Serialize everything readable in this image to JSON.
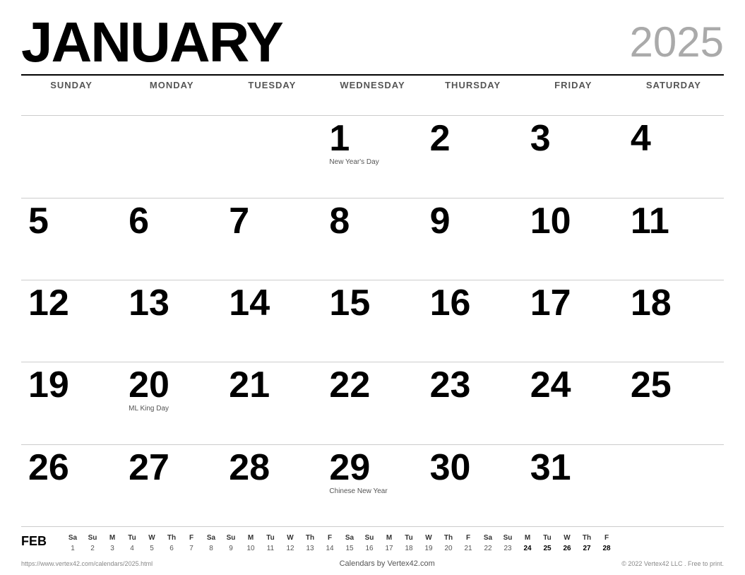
{
  "header": {
    "month": "JANUARY",
    "year": "2025"
  },
  "day_headers": [
    "SUNDAY",
    "MONDAY",
    "TUESDAY",
    "WEDNESDAY",
    "THURSDAY",
    "FRIDAY",
    "SATURDAY"
  ],
  "weeks": [
    [
      {
        "day": "",
        "holiday": ""
      },
      {
        "day": "",
        "holiday": ""
      },
      {
        "day": "",
        "holiday": ""
      },
      {
        "day": "1",
        "holiday": "New Year's Day"
      },
      {
        "day": "2",
        "holiday": ""
      },
      {
        "day": "3",
        "holiday": ""
      },
      {
        "day": "4",
        "holiday": ""
      }
    ],
    [
      {
        "day": "5",
        "holiday": ""
      },
      {
        "day": "6",
        "holiday": ""
      },
      {
        "day": "7",
        "holiday": ""
      },
      {
        "day": "8",
        "holiday": ""
      },
      {
        "day": "9",
        "holiday": ""
      },
      {
        "day": "10",
        "holiday": ""
      },
      {
        "day": "11",
        "holiday": ""
      }
    ],
    [
      {
        "day": "12",
        "holiday": ""
      },
      {
        "day": "13",
        "holiday": ""
      },
      {
        "day": "14",
        "holiday": ""
      },
      {
        "day": "15",
        "holiday": ""
      },
      {
        "day": "16",
        "holiday": ""
      },
      {
        "day": "17",
        "holiday": ""
      },
      {
        "day": "18",
        "holiday": ""
      }
    ],
    [
      {
        "day": "19",
        "holiday": ""
      },
      {
        "day": "20",
        "holiday": "ML King Day"
      },
      {
        "day": "21",
        "holiday": ""
      },
      {
        "day": "22",
        "holiday": ""
      },
      {
        "day": "23",
        "holiday": ""
      },
      {
        "day": "24",
        "holiday": ""
      },
      {
        "day": "25",
        "holiday": ""
      }
    ],
    [
      {
        "day": "26",
        "holiday": ""
      },
      {
        "day": "27",
        "holiday": ""
      },
      {
        "day": "28",
        "holiday": ""
      },
      {
        "day": "29",
        "holiday": "Chinese New Year"
      },
      {
        "day": "30",
        "holiday": ""
      },
      {
        "day": "31",
        "holiday": ""
      },
      {
        "day": "",
        "holiday": ""
      }
    ]
  ],
  "mini_calendar": {
    "label": "FEB",
    "headers": [
      "Sa",
      "Su",
      "M",
      "Tu",
      "W",
      "Th",
      "F",
      "Sa",
      "Su",
      "M",
      "Tu",
      "W",
      "Th",
      "F",
      "Sa",
      "Su",
      "M",
      "Tu",
      "W",
      "Th",
      "F",
      "Sa",
      "Su",
      "M",
      "Tu",
      "W",
      "Th",
      "F"
    ],
    "days": [
      "1",
      "2",
      "3",
      "4",
      "5",
      "6",
      "7",
      "8",
      "9",
      "10",
      "11",
      "12",
      "13",
      "14",
      "15",
      "16",
      "17",
      "18",
      "19",
      "20",
      "21",
      "22",
      "23",
      "24",
      "25",
      "26",
      "27",
      "28"
    ]
  },
  "footer": {
    "left": "https://www.vertex42.com/calendars/2025.html",
    "center": "Calendars by Vertex42.com",
    "right": "© 2022 Vertex42 LLC . Free to print."
  }
}
